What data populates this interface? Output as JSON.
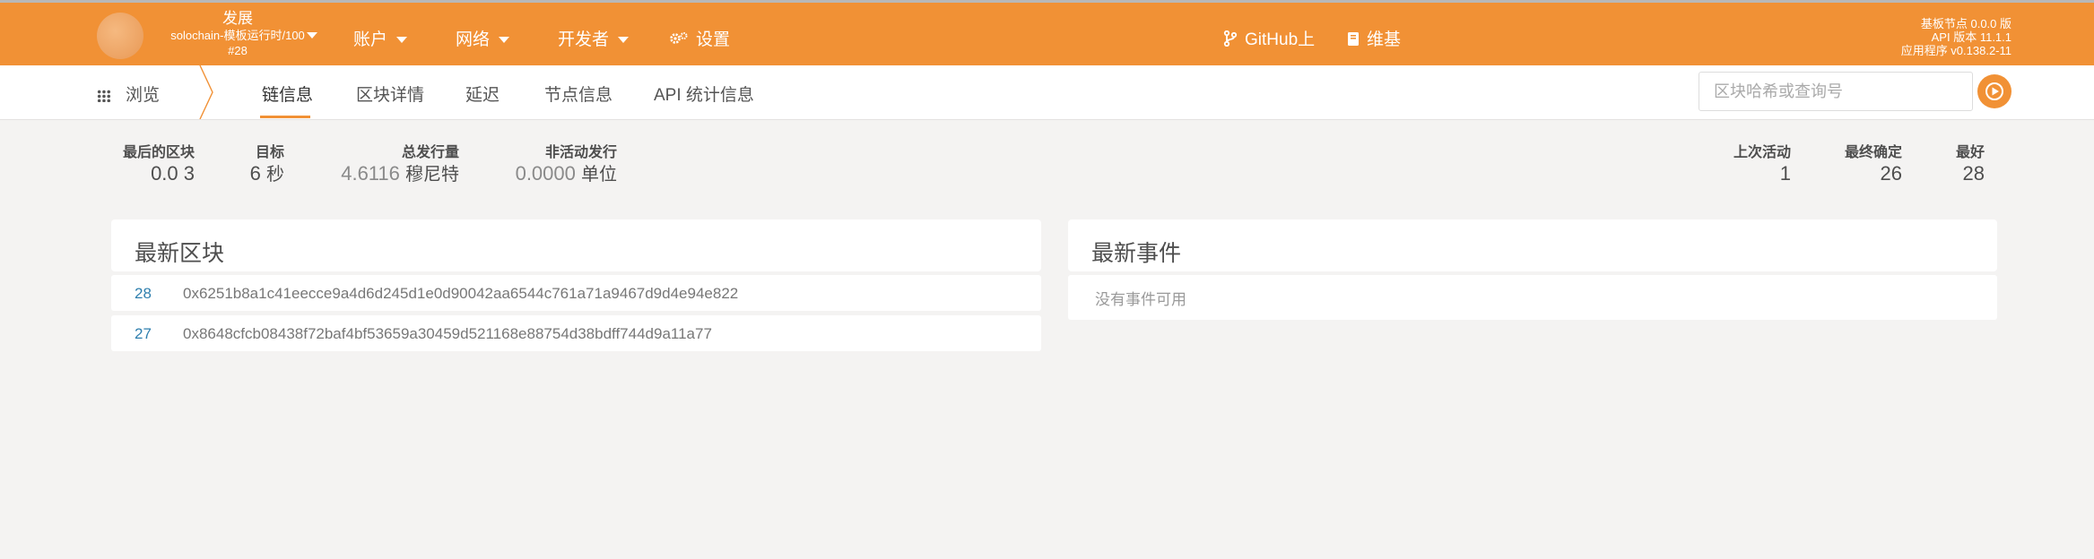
{
  "header": {
    "chain": {
      "line1": "发展",
      "line2": "solochain-模板运行时/100",
      "line3": "#28"
    },
    "menu": [
      {
        "label": "账户"
      },
      {
        "label": "网络"
      },
      {
        "label": "开发者"
      }
    ],
    "settings_label": "设置",
    "github_label": "GitHub上",
    "wiki_label": "维基",
    "versions": {
      "node": "基板节点 0.0.0 版",
      "api": "API 版本 11.1.1",
      "app": "应用程序 v0.138.2-11"
    },
    "accent_color": "#f19135"
  },
  "subnav": {
    "browse_label": "浏览",
    "tabs": [
      "链信息",
      "区块详情",
      "延迟",
      "节点信息",
      "API 统计信息"
    ],
    "active_tab": "链信息",
    "search_placeholder": "区块哈希或查询号"
  },
  "stats": {
    "last_block": {
      "label": "最后的区块",
      "value": "0.0 3"
    },
    "target": {
      "label": "目标",
      "value": "6",
      "unit": "秒"
    },
    "total_issuance": {
      "label": "总发行量",
      "value": "4.6116",
      "unit": "穆尼特"
    },
    "inactive_issuance": {
      "label": "非活动发行",
      "value": "0.0000",
      "unit": "单位"
    },
    "last_active": {
      "label": "上次活动",
      "value": "1"
    },
    "finalized": {
      "label": "最终确定",
      "value": "26"
    },
    "best": {
      "label": "最好",
      "value": "28"
    }
  },
  "recent_blocks": {
    "title": "最新区块",
    "rows": [
      {
        "number": "28",
        "hash": "0x6251b8a1c41eecce9a4d6d245d1e0d90042aa6544c761a71a9467d9d4e94e822"
      },
      {
        "number": "27",
        "hash": "0x8648cfcb08438f72baf4bf53659a30459d521168e88754d38bdff744d9a11a77"
      }
    ]
  },
  "recent_events": {
    "title": "最新事件",
    "empty_text": "没有事件可用"
  }
}
